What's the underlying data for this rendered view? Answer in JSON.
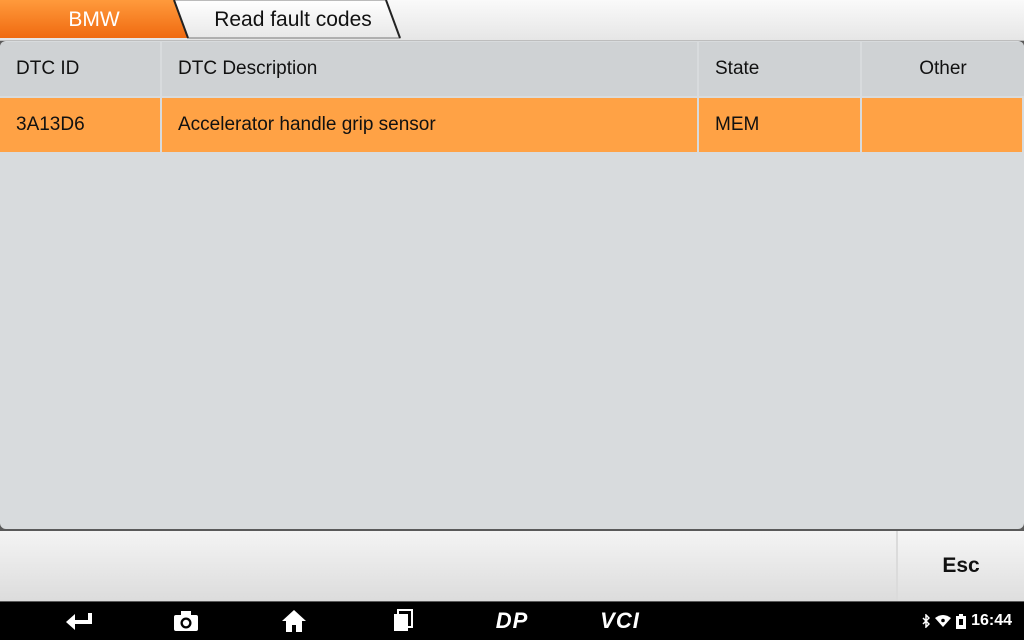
{
  "breadcrumb": {
    "brand": "BMW",
    "page": "Read fault codes"
  },
  "table": {
    "headers": [
      "DTC ID",
      "DTC Description",
      "State",
      "Other"
    ],
    "rows": [
      [
        "3A13D6",
        "Accelerator handle grip sensor",
        "MEM",
        ""
      ]
    ]
  },
  "toolbar": {
    "esc_label": "Esc"
  },
  "navbar": {
    "items": [
      "back-icon",
      "camera-icon",
      "home-icon",
      "recent-apps-icon",
      "dp-icon",
      "vci-icon"
    ],
    "dp_label": "DP",
    "vci_label": "VCI"
  },
  "status": {
    "time": "16:44",
    "icons": [
      "bluetooth-icon",
      "wifi-icon",
      "battery-icon"
    ]
  },
  "colors": {
    "accent": "#f07a18",
    "selected_row": "#ffa245",
    "panel": "#d8dbdd"
  }
}
